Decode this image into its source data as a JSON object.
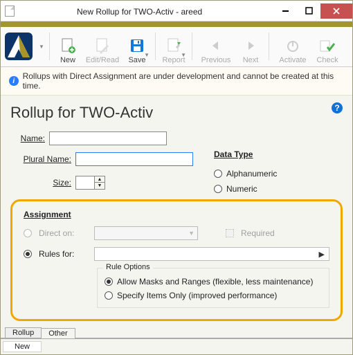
{
  "window": {
    "title": "New Rollup for TWO-Activ - areed"
  },
  "toolbar": {
    "new": "New",
    "edit_read": "Edit/Read",
    "save": "Save",
    "report": "Report",
    "previous": "Previous",
    "next": "Next",
    "activate": "Activate",
    "check": "Check"
  },
  "banner": {
    "text": "Rollups with Direct Assignment are under development and cannot be created at this time."
  },
  "page": {
    "heading": "Rollup for TWO-Activ",
    "name_label": "Name:",
    "plural_label": "Plural Name:",
    "size_label": "Size:",
    "name_value": "",
    "plural_value": "",
    "size_value": ""
  },
  "data_type": {
    "group": "Data Type",
    "alpha": "Alphanumeric",
    "numeric": "Numeric"
  },
  "assignment": {
    "group": "Assignment",
    "direct_on": "Direct on:",
    "required": "Required",
    "rules_for": "Rules for:",
    "rule_options": "Rule Options",
    "allow_masks": "Allow Masks and Ranges (flexible, less maintenance)",
    "specify_items": "Specify Items Only (improved performance)"
  },
  "tabs": {
    "rollup": "Rollup",
    "other": "Other"
  },
  "status": {
    "text": "New"
  }
}
